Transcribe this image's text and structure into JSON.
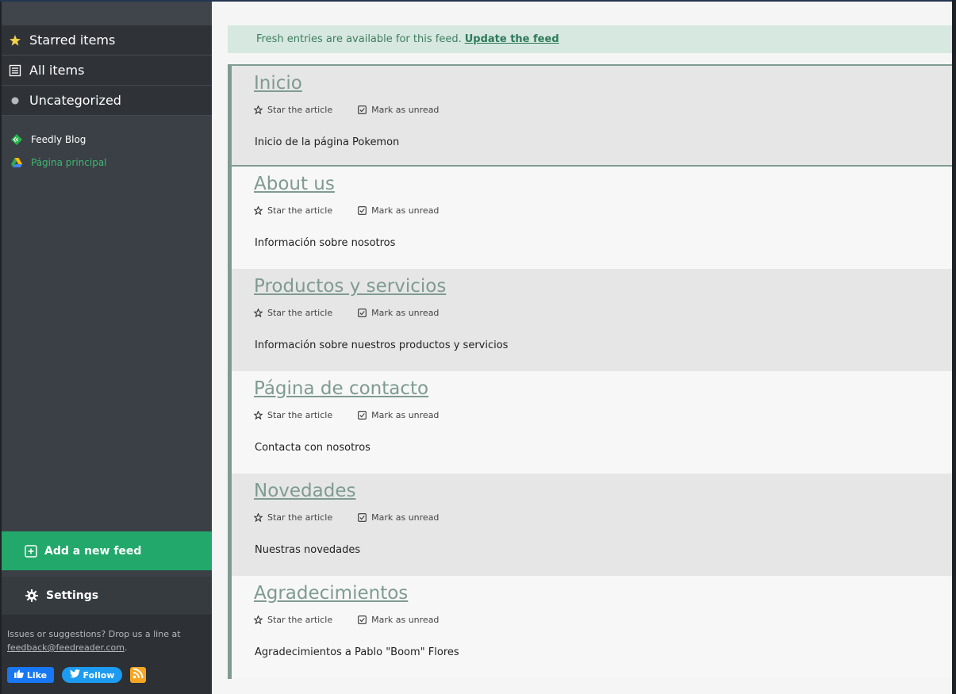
{
  "sidebar": {
    "nav": [
      {
        "label": "Starred items",
        "icon": "star-icon"
      },
      {
        "label": "All items",
        "icon": "list-icon"
      },
      {
        "label": "Uncategorized",
        "icon": "dot-icon"
      }
    ],
    "feeds": [
      {
        "label": "Feedly Blog",
        "icon": "feedly-icon"
      },
      {
        "label": "Página principal",
        "icon": "google-drive-icon"
      }
    ],
    "add_feed_label": "Add a new feed",
    "settings_label": "Settings",
    "footer": {
      "text": "Issues or suggestions? Drop us a line at",
      "email": "feedback@feedreader.com",
      "period": ".",
      "like_label": "Like",
      "follow_label": "Follow"
    }
  },
  "main": {
    "notice": {
      "text": "Fresh entries are available for this feed.",
      "link": "Update the feed"
    },
    "star_label": "Star the article",
    "unread_label": "Mark as unread",
    "articles": [
      {
        "title": "Inicio",
        "desc": "Inicio de la página Pokemon"
      },
      {
        "title": "About us",
        "desc": "Información sobre nosotros"
      },
      {
        "title": "Productos y servicios",
        "desc": "Información sobre nuestros productos y servicios"
      },
      {
        "title": "Página de contacto",
        "desc": "Contacta con nosotros"
      },
      {
        "title": "Novedades",
        "desc": "Nuestras novedades"
      },
      {
        "title": "Agradecimientos",
        "desc": "Agradecimientos a Pablo \"Boom\" Flores"
      }
    ]
  },
  "colors": {
    "accent_green": "#22a86a",
    "title_color": "#7f9b91",
    "sidebar_bg": "#3a4046"
  }
}
